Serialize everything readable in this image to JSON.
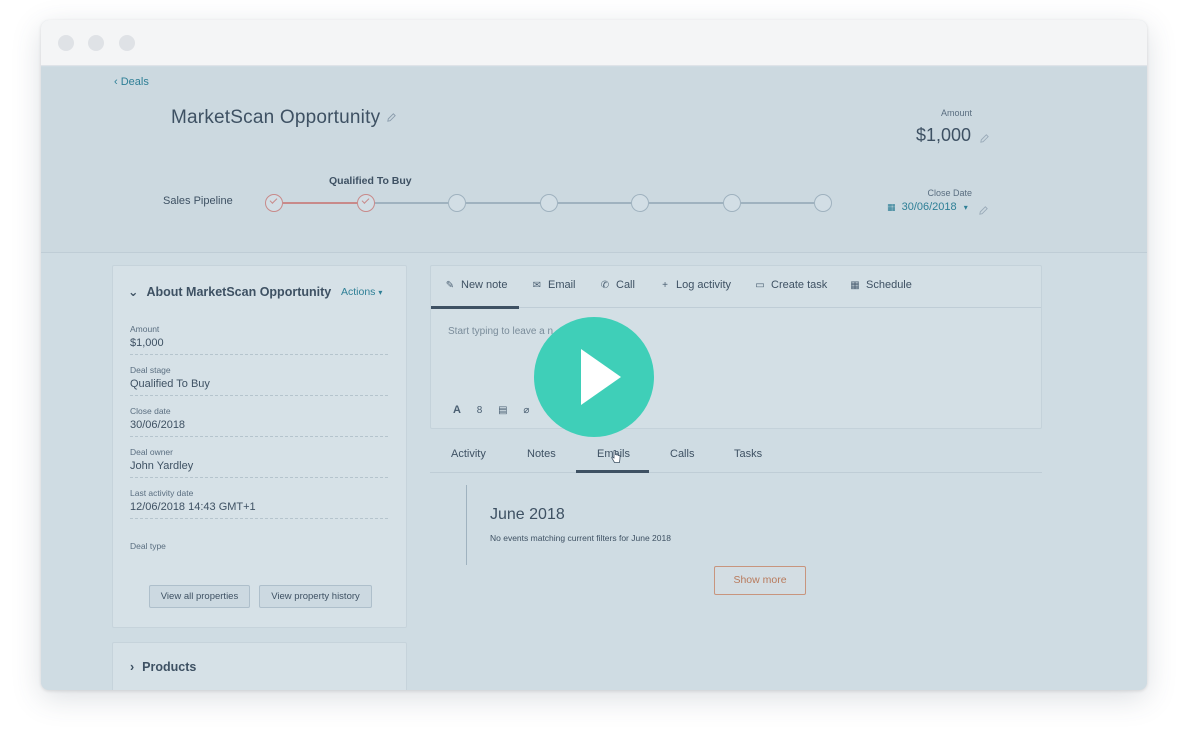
{
  "window": {
    "traffic_dots": 3
  },
  "breadcrumb": {
    "back_label": "‹ Deals"
  },
  "deal": {
    "title": "MarketScan Opportunity",
    "amount_label": "Amount",
    "amount_value": "$1,000",
    "pipeline_label": "Sales Pipeline",
    "current_stage": "Qualified To Buy",
    "stages_total": 7,
    "stages_completed": 2,
    "close_date_label": "Close Date",
    "close_date_value": "30/06/2018"
  },
  "about_card": {
    "title": "About MarketScan Opportunity",
    "actions_label": "Actions",
    "properties": [
      {
        "label": "Amount",
        "value": "$1,000"
      },
      {
        "label": "Deal stage",
        "value": "Qualified To Buy"
      },
      {
        "label": "Close date",
        "value": "30/06/2018"
      },
      {
        "label": "Deal owner",
        "value": "John Yardley"
      },
      {
        "label": "Last activity date",
        "value": "12/06/2018 14:43 GMT+1"
      },
      {
        "label": "Deal type",
        "value": ""
      }
    ],
    "view_all_label": "View all properties",
    "view_history_label": "View property history"
  },
  "products_card": {
    "title": "Products"
  },
  "editor": {
    "tabs": [
      {
        "label": "New note",
        "icon": "edit-icon"
      },
      {
        "label": "Email",
        "icon": "email-icon"
      },
      {
        "label": "Call",
        "icon": "phone-icon"
      },
      {
        "label": "Log activity",
        "icon": "plus-icon"
      },
      {
        "label": "Create task",
        "icon": "task-icon"
      },
      {
        "label": "Schedule",
        "icon": "calendar-icon"
      }
    ],
    "placeholder": "Start typing to leave a n",
    "format_tools": [
      "A",
      "8",
      "▤",
      "⌀"
    ]
  },
  "filter_tabs": [
    {
      "label": "Activity"
    },
    {
      "label": "Notes"
    },
    {
      "label": "Emails"
    },
    {
      "label": "Calls"
    },
    {
      "label": "Tasks"
    }
  ],
  "timeline": {
    "month": "June 2018",
    "empty_message": "No events matching current filters for June 2018",
    "show_more_label": "Show more"
  },
  "colors": {
    "overlay_bg": "#cfdce3",
    "accent_link": "#2e7f96",
    "play_button": "#3fcfb8",
    "stage_done": "#c88a8a",
    "show_more_border": "#c8957e"
  }
}
